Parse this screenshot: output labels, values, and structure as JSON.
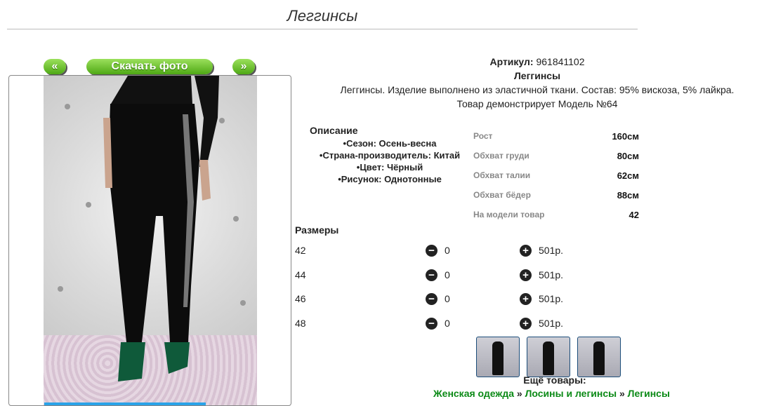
{
  "title": "Леггинсы",
  "nav": {
    "prev": "«",
    "download": "Скачать фото",
    "next": "»"
  },
  "product": {
    "article_label": "Артикул:",
    "article": "961841102",
    "name": "Леггинсы",
    "description": "Леггинсы. Изделие выполнено из эластичной ткани. Состав: 95% вискоза, 5% лайкра.",
    "model_note": "Товар демонстрирует Модель №64"
  },
  "description_block": {
    "title": "Описание",
    "items": [
      "Сезон: Осень-весна",
      "Страна-производитель: Китай",
      "Цвет: Чёрный",
      "Рисунок: Однотонные"
    ]
  },
  "measures": [
    {
      "label": "Рост",
      "value": "160см"
    },
    {
      "label": "Обхват груди",
      "value": "80см"
    },
    {
      "label": "Обхват талии",
      "value": "62см"
    },
    {
      "label": "Обхват бёдер",
      "value": "88см"
    },
    {
      "label": "На модели товар",
      "value": "42"
    }
  ],
  "sizes": {
    "title": "Размеры",
    "rows": [
      {
        "size": "42",
        "qty": "0",
        "price": "501р."
      },
      {
        "size": "44",
        "qty": "0",
        "price": "501р."
      },
      {
        "size": "46",
        "qty": "0",
        "price": "501р."
      },
      {
        "size": "48",
        "qty": "0",
        "price": "501р."
      }
    ]
  },
  "more_title": "Ещё товары:",
  "breadcrumbs": [
    "Женская одежда",
    "Лосины и легинсы",
    "Легинсы"
  ],
  "breadcrumb_sep": "»",
  "colors": {
    "accent_green": "#4ea814",
    "link_green": "#0b8a16"
  }
}
